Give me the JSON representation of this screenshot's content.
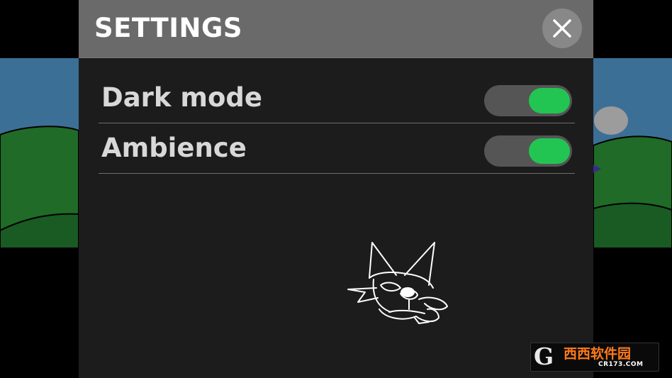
{
  "settings": {
    "title": "SETTINGS",
    "rows": [
      {
        "label": "Dark mode",
        "on": true
      },
      {
        "label": "Ambience",
        "on": true
      }
    ]
  },
  "watermark": {
    "name": "西西软件园",
    "url": "CR173.COM"
  },
  "colors": {
    "toggle_on": "#22c552",
    "header": "#6a6a6a",
    "panel": "#1c1c1c",
    "sky": "#3c6f96",
    "hill": "#1f6b27"
  },
  "icons": {
    "close": "close-icon",
    "cat_doodle": "cat-doodle-icon"
  }
}
